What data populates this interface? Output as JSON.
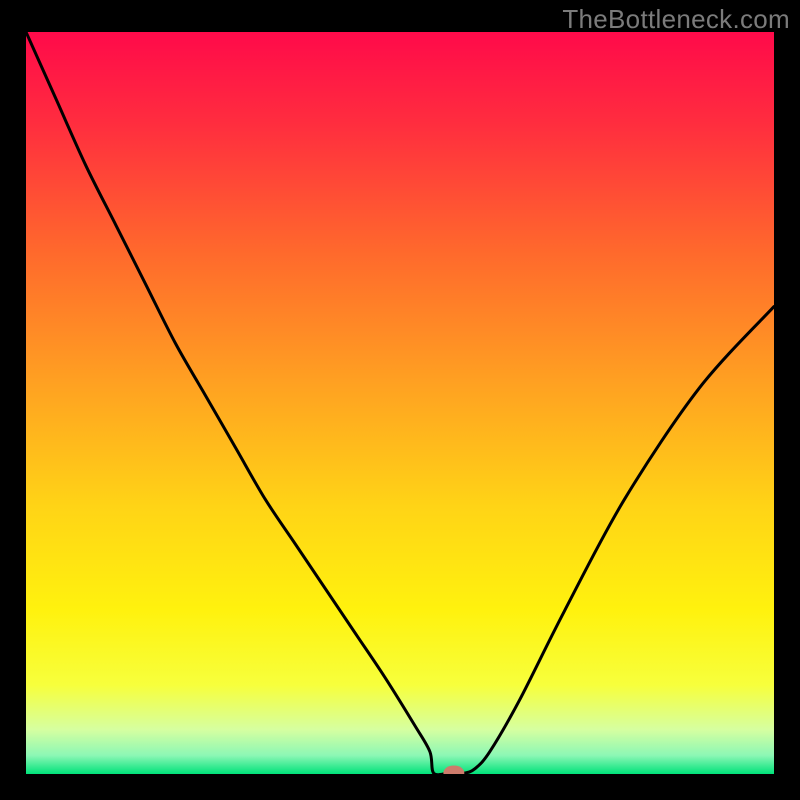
{
  "watermark": "TheBottleneck.com",
  "chart_data": {
    "type": "line",
    "title": "",
    "xlabel": "",
    "ylabel": "",
    "xlim": [
      0,
      100
    ],
    "ylim": [
      0,
      100
    ],
    "background_gradient": [
      {
        "pos": 0.0,
        "color": "#ff0a4a"
      },
      {
        "pos": 0.12,
        "color": "#ff2c3f"
      },
      {
        "pos": 0.3,
        "color": "#ff6a2c"
      },
      {
        "pos": 0.48,
        "color": "#ffa321"
      },
      {
        "pos": 0.64,
        "color": "#ffd416"
      },
      {
        "pos": 0.78,
        "color": "#fff20e"
      },
      {
        "pos": 0.88,
        "color": "#f7ff3c"
      },
      {
        "pos": 0.94,
        "color": "#d6ffa0"
      },
      {
        "pos": 0.975,
        "color": "#8cf7b5"
      },
      {
        "pos": 1.0,
        "color": "#00e27a"
      }
    ],
    "series": [
      {
        "name": "bottleneck-curve",
        "x": [
          0,
          4,
          8,
          12,
          16,
          20,
          24,
          28,
          32,
          36,
          40,
          44,
          48,
          52,
          54,
          56,
          57,
          58,
          60,
          62,
          66,
          72,
          80,
          90,
          100
        ],
        "y": [
          100,
          91,
          82,
          74,
          66,
          58,
          51,
          44,
          37,
          31,
          25,
          19,
          13,
          6.5,
          3,
          1,
          0.4,
          0.2,
          0.7,
          3,
          10,
          22,
          37,
          52,
          63
        ]
      }
    ],
    "flat_bottom": {
      "x_start": 54.5,
      "x_end": 58.5,
      "y": 0.1
    },
    "marker": {
      "x": 57.2,
      "y": 0.15,
      "rx": 1.4,
      "ry": 1.0,
      "color": "#cd7b6b"
    }
  }
}
